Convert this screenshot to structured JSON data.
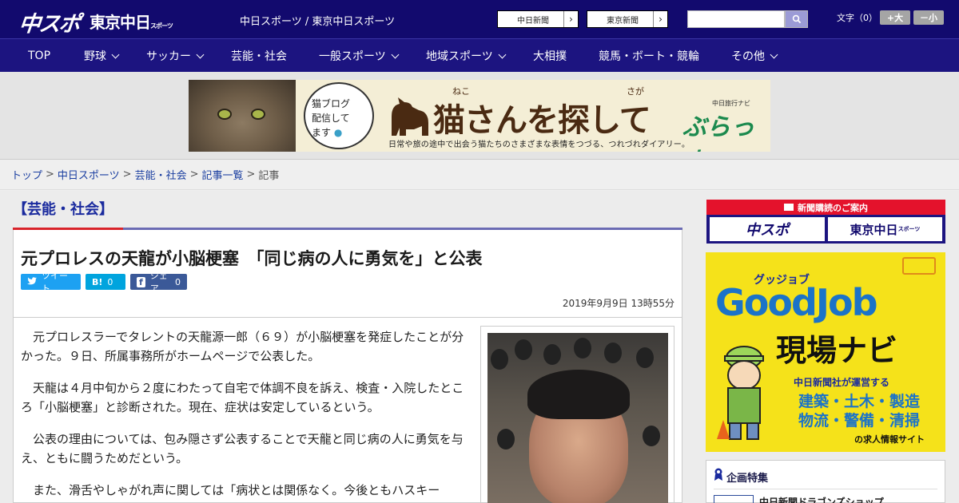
{
  "header": {
    "logo_chuspo": "中スポ",
    "logo_tokyo": "東京中日",
    "logo_tokyo_suffix": "スポーツ",
    "site_title": "中日スポーツ / 東京中日スポーツ",
    "paper_links": [
      "中日新聞",
      "東京新聞"
    ],
    "search": {
      "value": "",
      "placeholder": ""
    },
    "font_size_label": "文字（0）",
    "font_bigger": "+大",
    "font_smaller": "－小"
  },
  "nav": {
    "items": [
      {
        "label": "TOP",
        "has_menu": false
      },
      {
        "label": "野球",
        "has_menu": true
      },
      {
        "label": "サッカー",
        "has_menu": true
      },
      {
        "label": "芸能・社会",
        "has_menu": false
      },
      {
        "label": "一般スポーツ",
        "has_menu": true
      },
      {
        "label": "地域スポーツ",
        "has_menu": true
      },
      {
        "label": "大相撲",
        "has_menu": false
      },
      {
        "label": "競馬・ボート・競輪",
        "has_menu": false
      },
      {
        "label": "その他",
        "has_menu": true
      }
    ]
  },
  "ad": {
    "speech": [
      "猫ブログ",
      "配信して",
      "ます"
    ],
    "title": "猫さんを探して",
    "ruby_neko": "ねこ",
    "ruby_saga": "さが",
    "brand_small": "中日旅行ナビ",
    "brand": "ぶらっ人",
    "subtitle": "日常や旅の途中で出会う猫たちのさまざまな表情をつづる、つれづれダイアリー。"
  },
  "breadcrumb": {
    "items": [
      "トップ",
      "中日スポーツ",
      "芸能・社会",
      "記事一覧",
      "記事"
    ],
    "separator": ">"
  },
  "article": {
    "category": "【芸能・社会】",
    "title": "元プロレスの天龍が小脳梗塞　「同じ病の人に勇気を」と公表",
    "share": {
      "tweet": "ツイート",
      "hatena_icon": "B!",
      "hatena_count": "0",
      "facebook_icon": "f",
      "facebook_label": "シェア",
      "facebook_count": "0"
    },
    "date": "2019年9月9日 13時55分",
    "paragraphs": [
      "元プロレスラーでタレントの天龍源一郎（６９）が小脳梗塞を発症したことが分かった。９日、所属事務所がホームページで公表した。",
      "天龍は４月中旬から２度にわたって自宅で体調不良を訴え、検査・入院したところ「小脳梗塞」と診断された。現在、症状は安定しているという。",
      "公表の理由については、包み隠さず公表することで天龍と同じ病の人に勇気を与え、ともに闘うためだという。",
      "また、滑舌やしゃがれ声に関しては「病状とは関係なく。今後ともハスキー"
    ]
  },
  "sidebar": {
    "subscription_head": "新聞購読のご案内",
    "subscription_items": [
      "中スポ",
      "東京中日"
    ],
    "subscription_suffix": "スポーツ",
    "goodjob": {
      "small": "グッジョブ",
      "big": "GoodJob",
      "navi": "現場ナビ",
      "line1": "中日新聞社が運営する",
      "line2": "建築・土木・製造",
      "line3": "物流・警備・清掃",
      "line4": "の求人情報サイト"
    },
    "feature_title": "企画特集",
    "feature_item": "中日新聞ドラゴンズショップ"
  },
  "colors": {
    "header_bg": "#120a6e",
    "nav_bg": "#1c1480",
    "accent_red": "#d8232a",
    "twitter": "#1da1f2",
    "hatena": "#00a4de",
    "facebook": "#3b5998",
    "goodjob_yellow": "#f5e21a"
  }
}
